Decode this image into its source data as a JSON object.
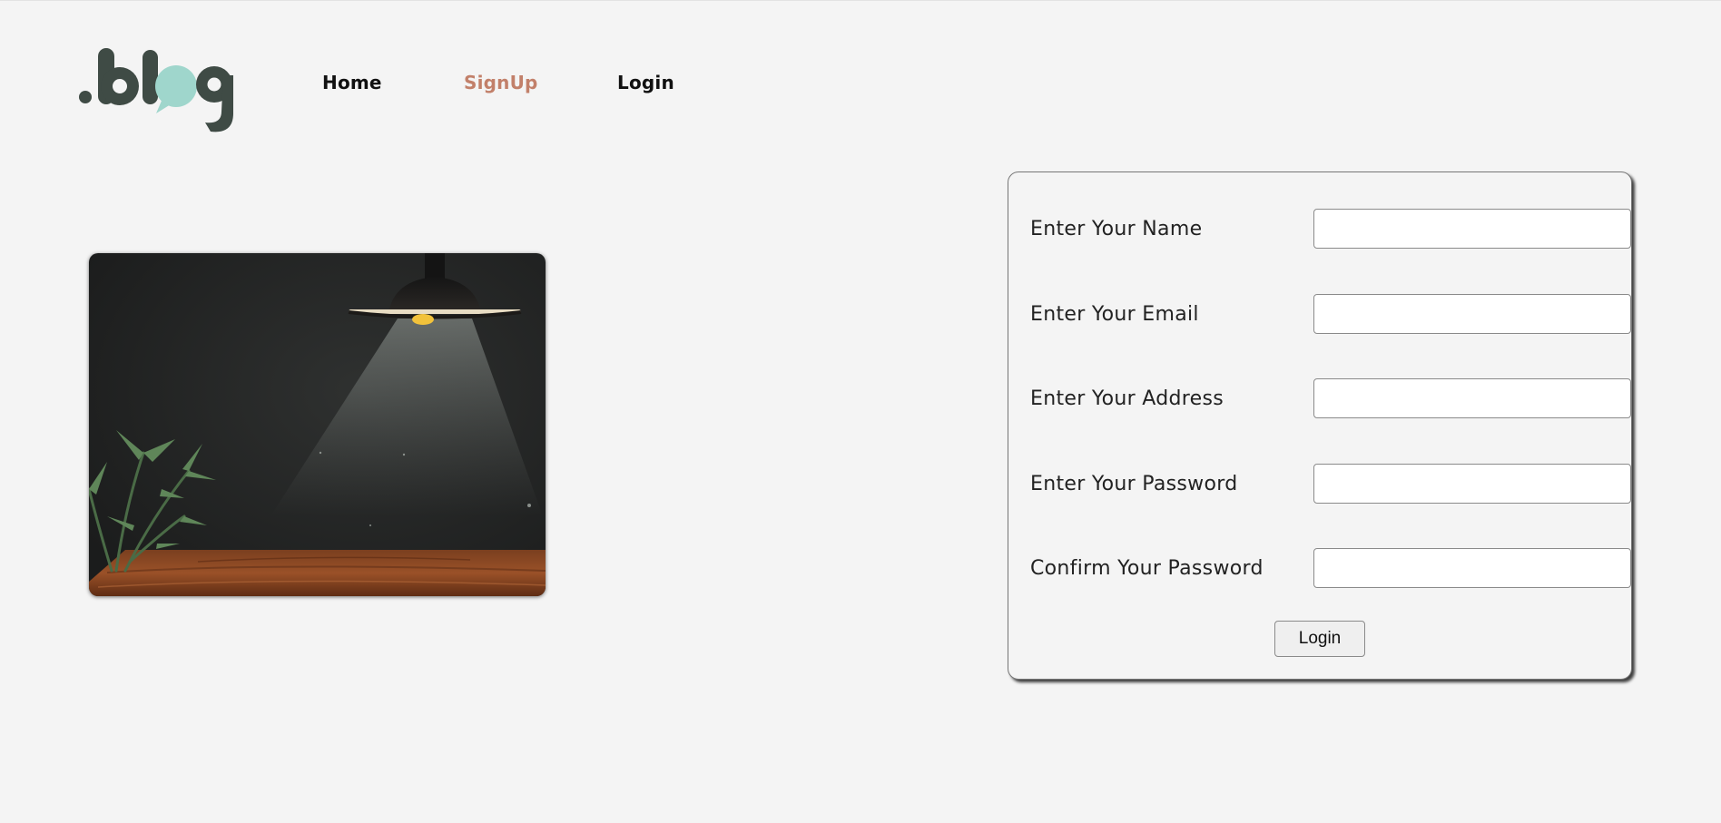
{
  "logo": {
    "text": ".blog",
    "colors": {
      "dark": "#3f4b45",
      "accent": "#9fd6cc"
    }
  },
  "nav": {
    "items": [
      {
        "label": "Home",
        "active": false,
        "color": "#111111"
      },
      {
        "label": "SignUp",
        "active": true,
        "color": "#c2806a"
      },
      {
        "label": "Login",
        "active": false,
        "color": "#111111"
      }
    ]
  },
  "illustration": {
    "description_icon": "room-lamp-plant-table-image"
  },
  "form": {
    "fields": [
      {
        "label": "Enter Your Name",
        "value": "",
        "placeholder": ""
      },
      {
        "label": "Enter Your Email",
        "value": "",
        "placeholder": ""
      },
      {
        "label": "Enter Your Address",
        "value": "",
        "placeholder": ""
      },
      {
        "label": "Enter Your Password",
        "value": "",
        "placeholder": ""
      },
      {
        "label": "Confirm Your Password",
        "value": "",
        "placeholder": ""
      }
    ],
    "submit_label": "Login"
  }
}
